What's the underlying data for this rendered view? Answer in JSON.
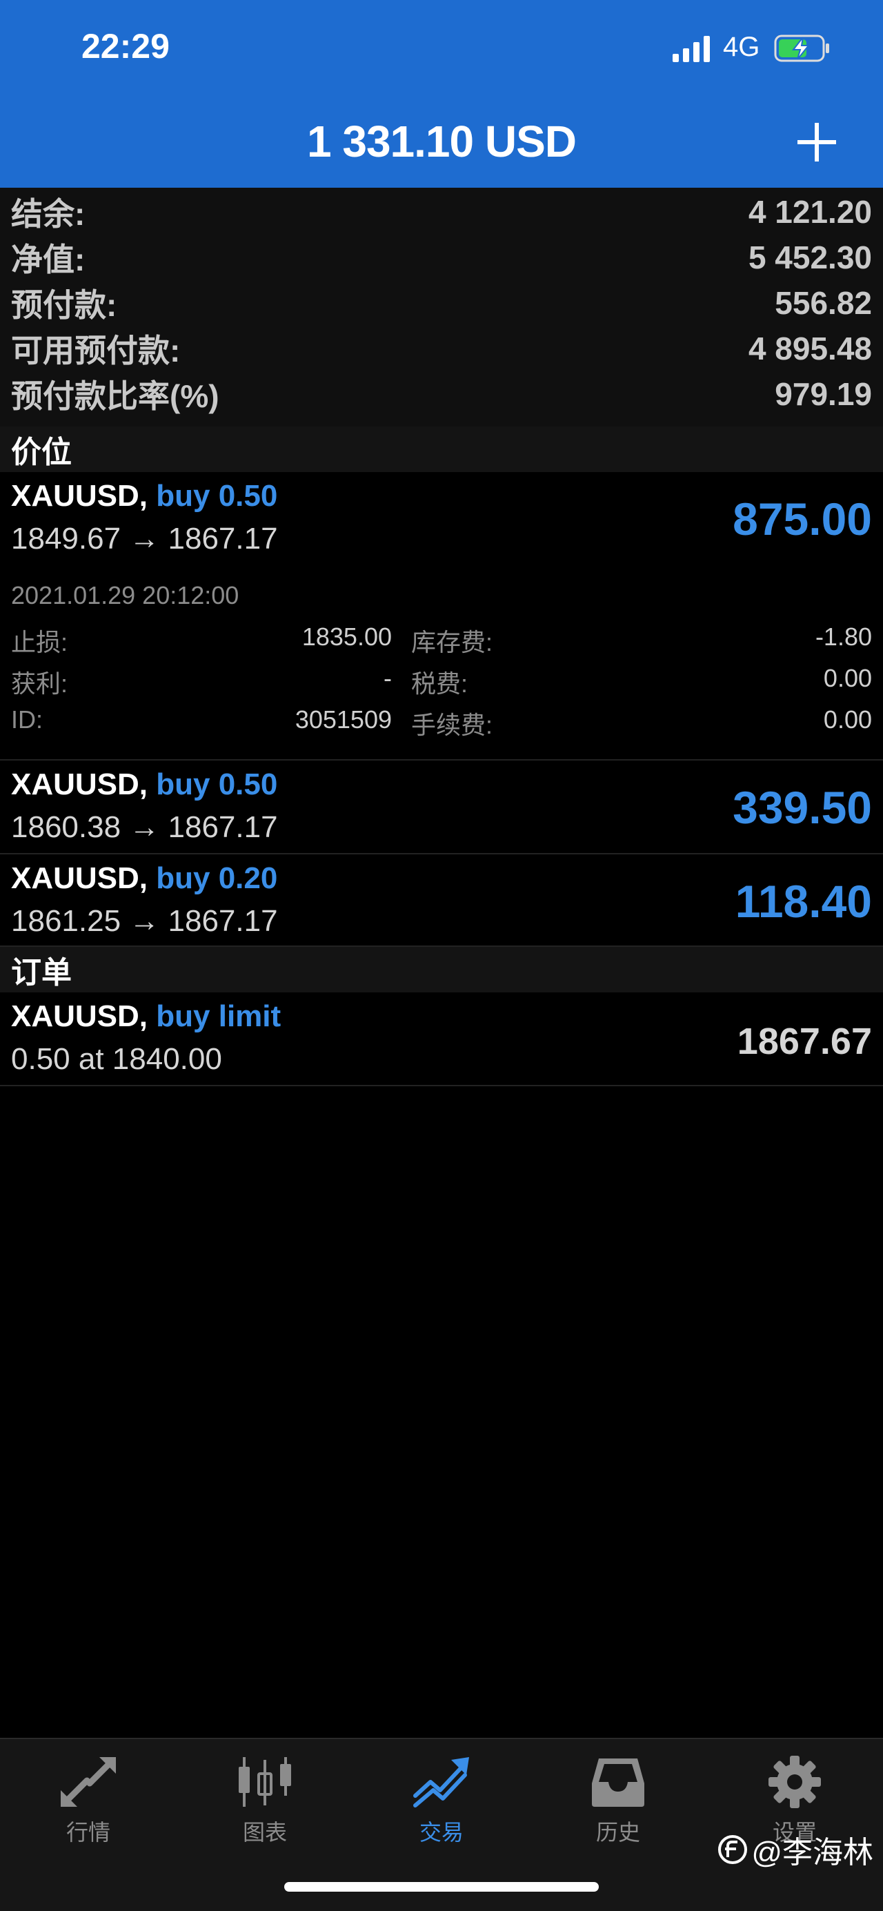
{
  "status_bar": {
    "time": "22:29",
    "network": "4G"
  },
  "header": {
    "balance_title": "1 331.10 USD"
  },
  "summary": [
    {
      "label": "结余:",
      "value": "4 121.20"
    },
    {
      "label": "净值:",
      "value": "5 452.30"
    },
    {
      "label": "预付款:",
      "value": "556.82"
    },
    {
      "label": "可用预付款:",
      "value": "4 895.48"
    },
    {
      "label": "预付款比率(%)",
      "value": "979.19"
    }
  ],
  "sections": {
    "positions": "价位",
    "orders": "订单"
  },
  "positions": [
    {
      "symbol": "XAUUSD,",
      "side": "buy 0.50",
      "prices": "1849.67 → 1867.17",
      "profit": "875.00",
      "time": "2021.01.29 20:12:00",
      "details": {
        "sl_label": "止损:",
        "sl_value": "1835.00",
        "tp_label": "获利:",
        "tp_value": "-",
        "id_label": "ID:",
        "id_value": "3051509",
        "swap_label": "库存费:",
        "swap_value": "-1.80",
        "tax_label": "税费:",
        "tax_value": "0.00",
        "fee_label": "手续费:",
        "fee_value": "0.00"
      }
    },
    {
      "symbol": "XAUUSD,",
      "side": "buy 0.50",
      "prices": "1860.38 → 1867.17",
      "profit": "339.50"
    },
    {
      "symbol": "XAUUSD,",
      "side": "buy 0.20",
      "prices": "1861.25 → 1867.17",
      "profit": "118.40"
    }
  ],
  "orders": [
    {
      "symbol": "XAUUSD,",
      "side": "buy limit",
      "desc": "0.50 at 1840.00",
      "price": "1867.67"
    }
  ],
  "tabs": [
    {
      "label": "行情",
      "icon": "quotes-arrows-icon"
    },
    {
      "label": "图表",
      "icon": "candlestick-chart-icon"
    },
    {
      "label": "交易",
      "icon": "trade-trend-icon"
    },
    {
      "label": "历史",
      "icon": "history-inbox-icon"
    },
    {
      "label": "设置",
      "icon": "gear-icon"
    }
  ],
  "active_tab": "交易",
  "watermark": "@李海林",
  "colors": {
    "header_bg": "#1e6cd0",
    "accent": "#3a8ee8",
    "background": "#000000"
  }
}
